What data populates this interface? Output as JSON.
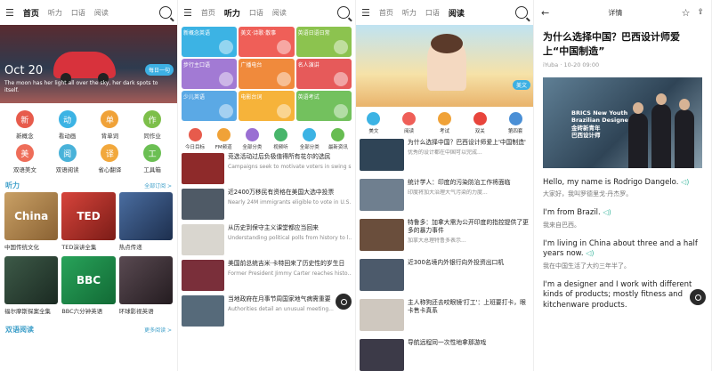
{
  "screen1": {
    "tabs": [
      "首页",
      "听力",
      "口语",
      "阅读"
    ],
    "active_tab": "首页",
    "hero": {
      "date": "Oct 20",
      "quote": "The moon has her light all over the sky, her dark spots to itself.",
      "tag": "每日一句"
    },
    "grid": [
      {
        "label": "新概念",
        "color": "#e75b4c",
        "icon": "新"
      },
      {
        "label": "看动画",
        "color": "#3cb3e4",
        "icon": "动"
      },
      {
        "label": "背单词",
        "color": "#f0a238",
        "icon": "单"
      },
      {
        "label": "同作业",
        "color": "#7dbf4a",
        "icon": "作"
      },
      {
        "label": "双语美文",
        "color": "#ee6d59",
        "icon": "美"
      },
      {
        "label": "双语阅读",
        "color": "#49b2d9",
        "icon": "阅"
      },
      {
        "label": "省心翻译",
        "color": "#f2a83c",
        "icon": "译"
      },
      {
        "label": "工具箱",
        "color": "#6bbf53",
        "icon": "工"
      }
    ],
    "listen": {
      "title": "听力",
      "more": "全部订阅 >"
    },
    "thumbs_row1": [
      {
        "cap": "中国传统文化",
        "text": "China",
        "color": "#b98c4e"
      },
      {
        "cap": "TED演讲全集",
        "text": "TED",
        "color": "#c8332d"
      },
      {
        "cap": "热点传递",
        "text": "",
        "color": "#3b5c8c"
      }
    ],
    "thumbs_row2": [
      {
        "cap": "福尔摩斯探案全集",
        "text": "",
        "color": "#2f4b3b"
      },
      {
        "cap": "BBC六分钟英语",
        "text": "BBC",
        "color": "#1f8a46"
      },
      {
        "cap": "环球影视英语",
        "text": "",
        "color": "#3a3036"
      }
    ],
    "reading": {
      "title": "双语阅读",
      "more": "更多阅读 >"
    }
  },
  "screen2": {
    "tabs": [
      "首页",
      "听力",
      "口语",
      "阅读"
    ],
    "active_tab": "听力",
    "tiles": [
      {
        "label": "新概念英语",
        "color": "#3cb3e4"
      },
      {
        "label": "美文·诗歌·散事",
        "color": "#ef5f58"
      },
      {
        "label": "英语日语日常",
        "color": "#8cc34f"
      },
      {
        "label": "步行主口语",
        "color": "#a27ad4"
      },
      {
        "label": "广播电台",
        "color": "#f08a3c"
      },
      {
        "label": "名人演讲",
        "color": "#e65a5a"
      },
      {
        "label": "少儿英语",
        "color": "#5ba9e5"
      },
      {
        "label": "电影台词",
        "color": "#f6b33a"
      },
      {
        "label": "英语考试",
        "color": "#73c15e"
      }
    ],
    "cats": [
      {
        "label": "今日目标",
        "color": "#e75b4c"
      },
      {
        "label": "FM频道",
        "color": "#f0a238"
      },
      {
        "label": "全部分类",
        "color": "#9a6fd3"
      },
      {
        "label": "视频听",
        "color": "#48b56a"
      },
      {
        "label": "全部分类",
        "color": "#3cb3e4"
      },
      {
        "label": "最新资讯",
        "color": "#67bd51"
      }
    ],
    "news": [
      {
        "title": "竞选活动过后负极值得所有花尔的选民",
        "sub": "Campaigns seek to motivate voters in swing s...",
        "color": "#8e2a2a"
      },
      {
        "title": "近2400万移民有资格在美国大选中投票",
        "sub": "Nearly 24M immigrants eligible to vote in U.S...",
        "color": "#4f5a66"
      },
      {
        "title": "从历史到保守主义课堂都应当回来",
        "sub": "Understanding political polls from history to l...",
        "color": "#d9d6cf"
      },
      {
        "title": "美国前总统吉米·卡特回来了历史性的岁生日",
        "sub": "Former President Jimmy Carter reaches histo...",
        "color": "#7a2f3a"
      },
      {
        "title": "当地政府在月事节周国家地气病需重要",
        "sub": "Authorities detail an unusual meeting...",
        "color": "#566a7a"
      }
    ]
  },
  "screen3": {
    "tabs": [
      "首页",
      "听力",
      "口语",
      "阅读"
    ],
    "active_tab": "阅读",
    "tag": "美文",
    "icons": [
      {
        "label": "美文",
        "color": "#3cb3e4"
      },
      {
        "label": "阅读",
        "color": "#ef5f58"
      },
      {
        "label": "考试",
        "color": "#f0a238"
      },
      {
        "label": "双关",
        "color": "#e8453c"
      },
      {
        "label": "第四套",
        "color": "#4a8fd6"
      }
    ],
    "news": [
      {
        "title": "为什么选择中国？巴西设计师爱上'中国制造'",
        "sub": "优秀的设计都在中国可以完成...",
        "color": "#2f4456"
      },
      {
        "title": "统计学人：印度的污染防治工作将面临",
        "sub": "印度将加大治理大气污染的力度...",
        "color": "#6f7f8f"
      },
      {
        "title": "特鲁多：加拿大需为公开印度的指控提供了更多的暴力事件",
        "sub": "加拿大总理特鲁多表示...",
        "color": "#6a4e3c"
      },
      {
        "title": "近300名境内外银行向外投资出口机",
        "sub": "",
        "color": "#4c5a6b"
      },
      {
        "title": "主人称狗还去咬眼镜'打工'：上班要打卡，眼卡售卡真系",
        "sub": "",
        "color": "#cfc8bf"
      },
      {
        "title": "导航远程同一次性地拿那游戏",
        "sub": "",
        "color": "#3c3a48"
      }
    ]
  },
  "screen4": {
    "title": "详情",
    "headline": "为什么选择中国？巴西设计师爱上“中国制造”",
    "meta": "iYuba · 10-20 09:00",
    "brics": "BRICS New Youth\nBrazilian Designer\n金砖新青年\n巴西设计师",
    "paragraphs": [
      {
        "en": "Hello, my name is Rodrigo Dangelo.",
        "zh": "大家好，我叫罗德里戈·丹杰罗。"
      },
      {
        "en": "I'm from Brazil.",
        "zh": "我来自巴西。"
      },
      {
        "en": "I'm living in China about three and a half years now.",
        "zh": "我在中国生活了大约三年半了。"
      },
      {
        "en": "I'm a designer and I work with different kinds of products; mostly fitness and kitchenware products.",
        "zh": ""
      }
    ]
  },
  "colors": {
    "accent": "#3e9fc9",
    "teal": "#3fb8a0"
  }
}
